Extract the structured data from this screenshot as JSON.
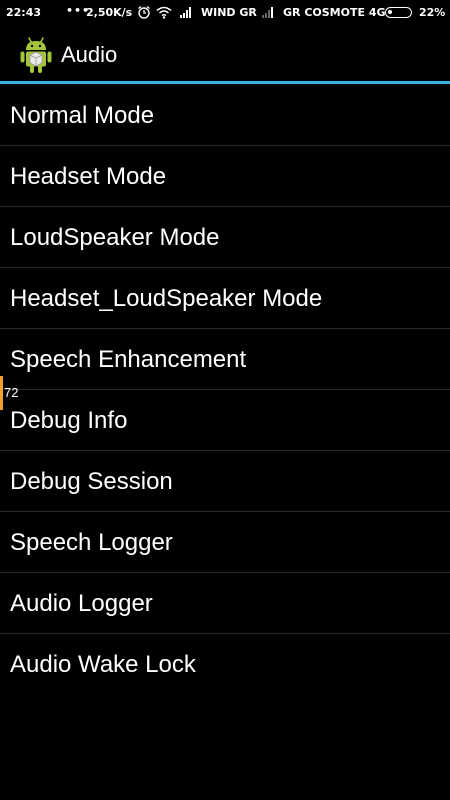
{
  "status_bar": {
    "time": "22:43",
    "network_speed": "2,50K/s",
    "carrier_1": "WIND GR",
    "carrier_2": "GR COSMOTE 4G",
    "battery_percent": "22%",
    "battery_level": 0.22,
    "icons": [
      "more-dots-icon",
      "alarm-clock-icon",
      "wifi-icon",
      "signal-bars-icon",
      "battery-icon"
    ]
  },
  "action_bar": {
    "title": "Audio",
    "icon": "android-robot-icon",
    "accent_color": "#3ab0e2"
  },
  "list": {
    "items": [
      {
        "label": "Normal Mode"
      },
      {
        "label": "Headset Mode"
      },
      {
        "label": "LoudSpeaker Mode"
      },
      {
        "label": "Headset_LoudSpeaker Mode"
      },
      {
        "label": "Speech Enhancement"
      },
      {
        "label": "Debug Info"
      },
      {
        "label": "Debug Session"
      },
      {
        "label": "Speech Logger"
      },
      {
        "label": "Audio Logger"
      },
      {
        "label": "Audio Wake Lock"
      }
    ]
  },
  "scroll_indicator": {
    "value": "72",
    "color": "#f0a030"
  }
}
